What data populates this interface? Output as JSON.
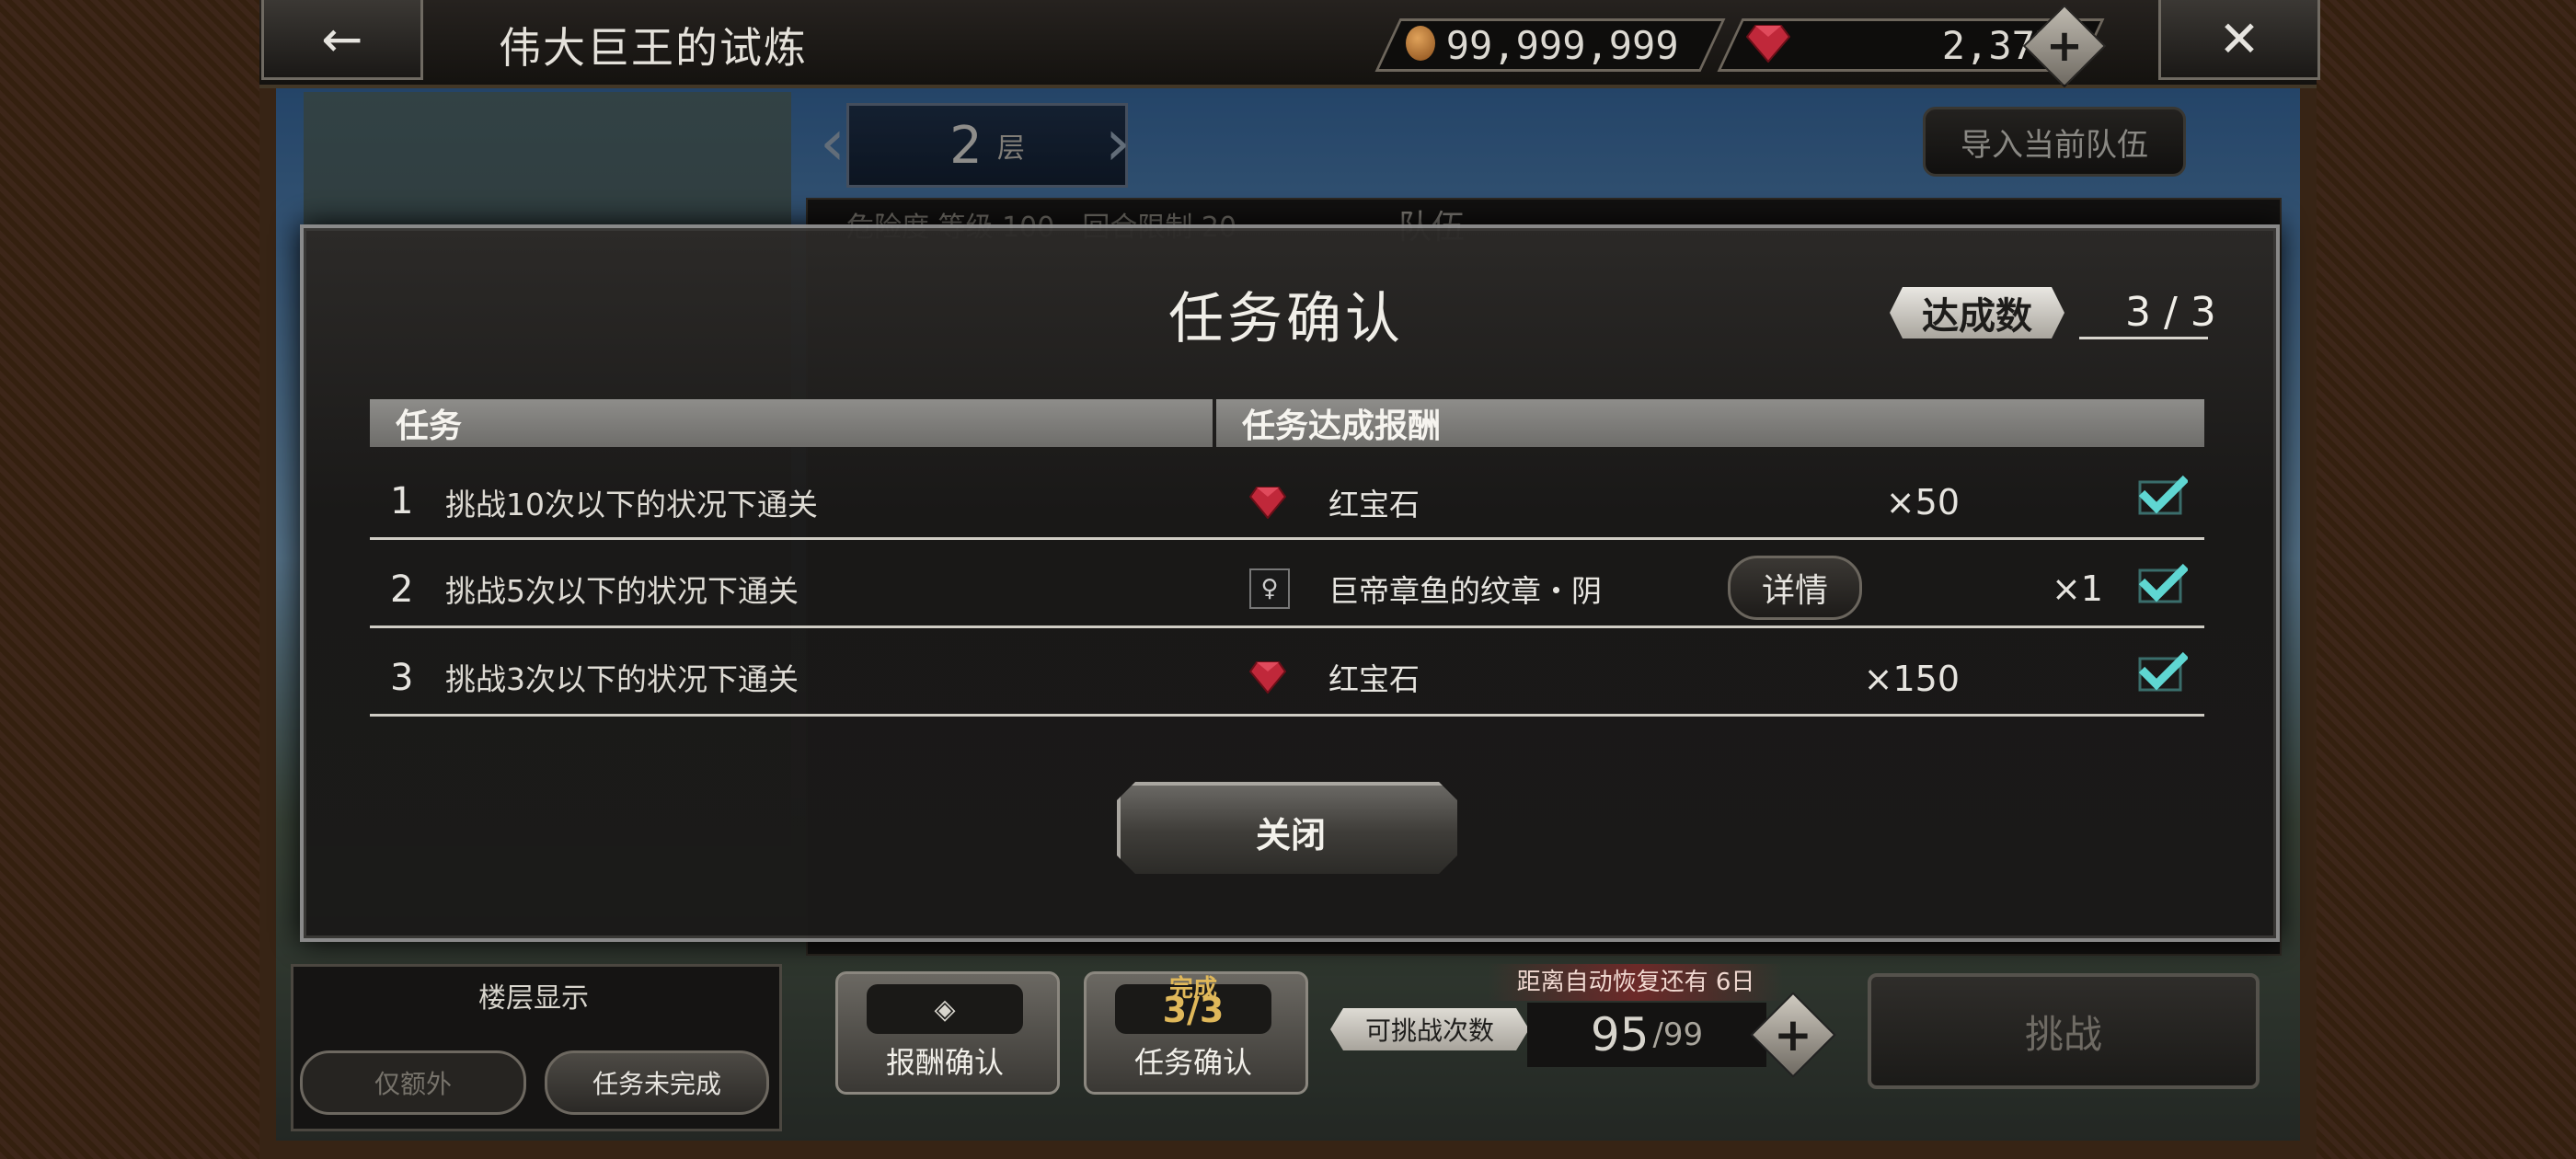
{
  "top_bar": {
    "title": "伟大巨王的试炼",
    "back_icon": "←",
    "close_icon": "✕",
    "gold_amount": "99,999,999",
    "gem_amount": "2,377",
    "add_icon": "+"
  },
  "floor": {
    "number": "2",
    "unit": "层",
    "import_team_label": "导入当前队伍",
    "info_text": "危险度 等级 100　回合限制 20",
    "team_label": "队伍"
  },
  "modal": {
    "title": "任务确认",
    "achieve_label": "达成数",
    "achieve_value": "3 / 3",
    "col_task": "任务",
    "col_reward": "任务达成报酬",
    "rows": [
      {
        "num": "1",
        "task": "挑战10次以下的状况下通关",
        "reward": "红宝石",
        "qty": "×50",
        "reward_icon": "ruby-icon"
      },
      {
        "num": "2",
        "task": "挑战5次以下的状况下通关",
        "reward": "巨帝章鱼的纹章・阴",
        "qty": "×1",
        "reward_icon": "crest-icon",
        "details_label": "详情"
      },
      {
        "num": "3",
        "task": "挑战3次以下的状况下通关",
        "reward": "红宝石",
        "qty": "×150",
        "reward_icon": "ruby-icon"
      }
    ],
    "close_label": "关闭"
  },
  "bottom": {
    "floor_display_label": "楼层显示",
    "filter_extra_label": "仅额外",
    "filter_incomplete_label": "任务未完成",
    "reward_confirm_label": "报酬确认",
    "task_confirm_label": "任务确认",
    "task_badge_top": "完成",
    "task_badge_count": "3/3",
    "tries_label": "可挑战次数",
    "recovery_note": "距离自动恢复还有 6日",
    "tries_current": "95",
    "tries_max": "/99",
    "challenge_label": "挑战"
  },
  "colors": {
    "check": "#5fd6d2",
    "ruby": "#c0283a",
    "accent_gold": "#e0b85a"
  }
}
